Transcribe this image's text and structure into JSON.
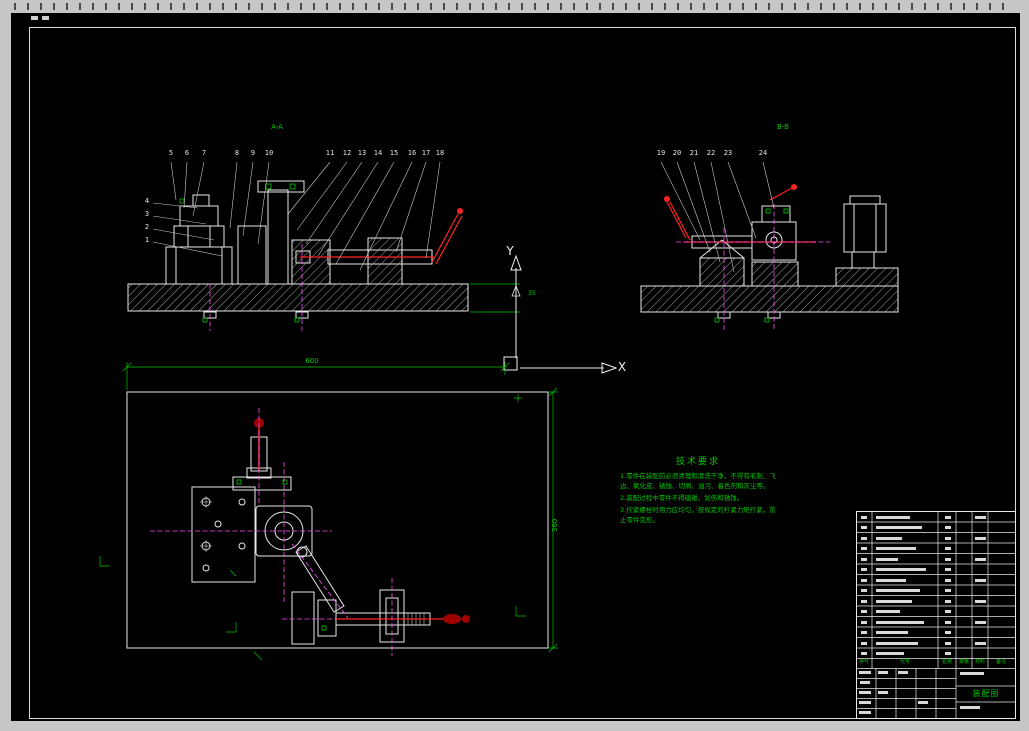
{
  "axes": {
    "x": "X",
    "y": "Y"
  },
  "views": {
    "front": {
      "section_label": "A-A",
      "callouts_top": [
        "5",
        "6",
        "7",
        "8",
        "9",
        "10",
        "11",
        "12",
        "13",
        "14",
        "15",
        "16",
        "17",
        "18"
      ],
      "callouts_left": [
        "4",
        "3",
        "2",
        "1"
      ],
      "dim_height": "35"
    },
    "side": {
      "section_label": "B-B",
      "callouts_top": [
        "19",
        "20",
        "21",
        "22",
        "23",
        "24"
      ]
    },
    "plan": {
      "dim_width": "600",
      "dim_height": "360"
    }
  },
  "tech_requirements": {
    "title": "技术要求",
    "lines": [
      "1.零件在装配前必须清理和清洗干净，不得有毛刺、飞边、氧化皮、锈蚀、切屑、油污、着色剂和灰尘等。",
      "2.装配过程中零件不得磕碰、划伤和锈蚀。",
      "3.拧紧螺栓时用力应均匀，按规定的拧紧力矩拧紧，防止零件变形。"
    ]
  },
  "title_block": {
    "drawing_name": "装配图",
    "bom_headers": [
      "序号",
      "代号",
      "名称",
      "数量",
      "材料",
      "备注"
    ]
  },
  "colors": {
    "canvas": "#000000",
    "line": "#e8e8e8",
    "dimension_green": "#00c800",
    "centerline_magenta": "#ff4dff",
    "handle_red": "#ff2222"
  }
}
